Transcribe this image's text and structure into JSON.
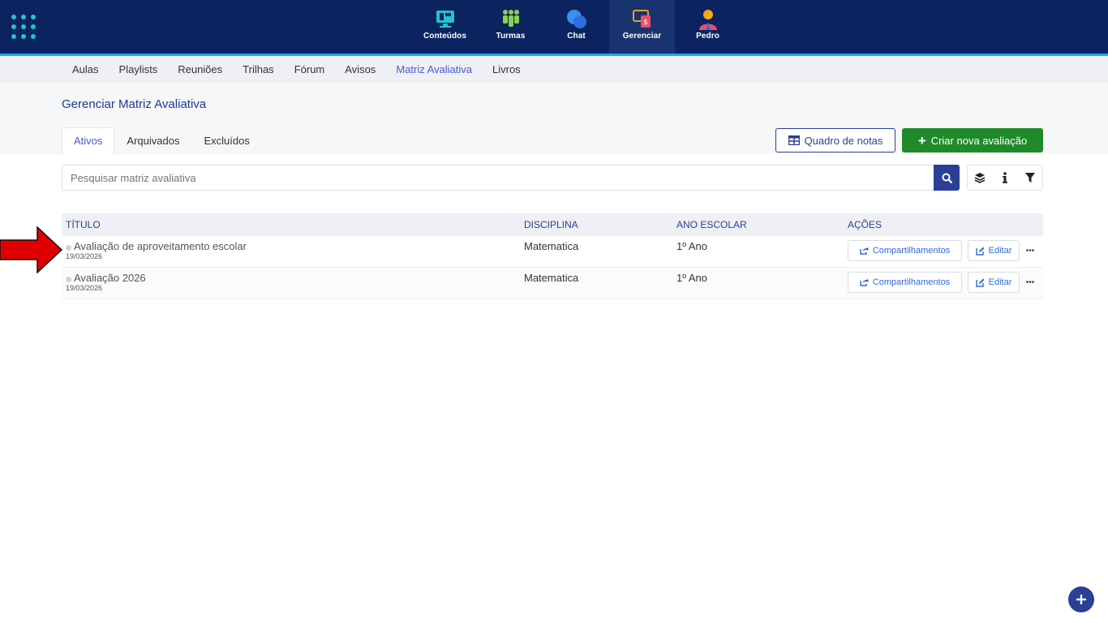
{
  "topnav": {
    "items": [
      {
        "label": "Conteúdos",
        "icon": "monitor-icon",
        "active": false
      },
      {
        "label": "Turmas",
        "icon": "people-icon",
        "active": false
      },
      {
        "label": "Chat",
        "icon": "chat-bubbles-icon",
        "active": false
      },
      {
        "label": "Gerenciar",
        "icon": "manage-devices-icon",
        "active": true
      },
      {
        "label": "Pedro",
        "icon": "user-avatar-icon",
        "active": false
      }
    ],
    "colors": {
      "bar": "#0b2460",
      "accent_line": "#1ea7f2"
    }
  },
  "subnav": {
    "items": [
      "Aulas",
      "Playlists",
      "Reuniões",
      "Trilhas",
      "Fórum",
      "Avisos",
      "Matriz Avaliativa",
      "Livros"
    ],
    "active": "Matriz Avaliativa"
  },
  "page": {
    "title": "Gerenciar Matriz Avaliativa",
    "tabs": [
      "Ativos",
      "Arquivados",
      "Excluídos"
    ],
    "active_tab": "Ativos",
    "btn_notas": "Quadro de notas",
    "btn_criar": "Criar nova avaliação"
  },
  "search": {
    "placeholder": "Pesquisar matriz avaliativa",
    "value": ""
  },
  "table": {
    "headers": {
      "titulo": "TÍTULO",
      "disciplina": "DISCIPLINA",
      "ano": "ANO ESCOLAR",
      "acoes": "AÇÕES"
    },
    "rows": [
      {
        "title": "Avaliação de aproveitamento escolar",
        "date": "19/03/2026",
        "disciplina": "Matematica",
        "ano": "1º Ano",
        "share_label": "Compartilhamentos",
        "edit_label": "Editar"
      },
      {
        "title": "Avaliação 2026",
        "date": "19/03/2026",
        "disciplina": "Matematica",
        "ano": "1º Ano",
        "share_label": "Compartilhamentos",
        "edit_label": "Editar"
      }
    ]
  },
  "colors": {
    "primary": "#2b3f95",
    "success": "#208a2a",
    "link": "#2e6ad9",
    "annotation": "#e00000"
  }
}
